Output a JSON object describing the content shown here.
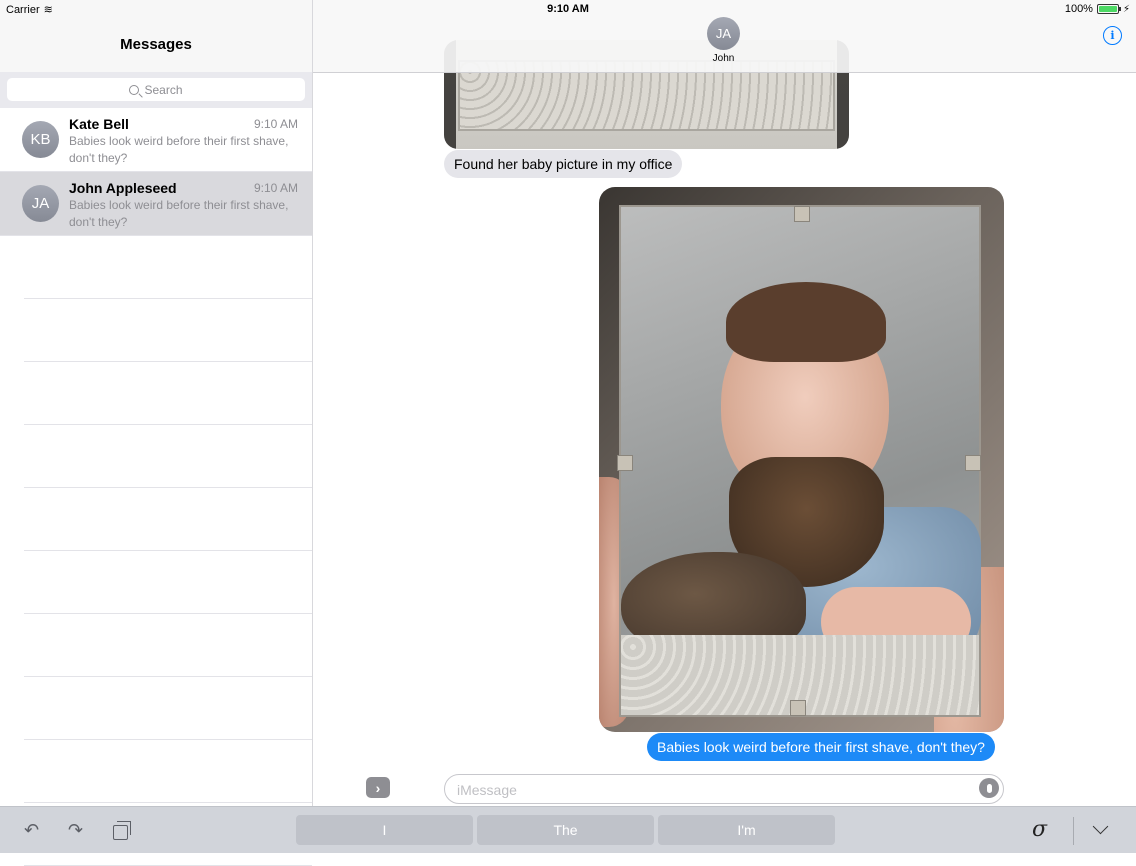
{
  "status_bar": {
    "carrier": "Carrier",
    "time": "9:10 AM",
    "battery": "100%"
  },
  "sidebar": {
    "title": "Messages",
    "search_placeholder": "Search",
    "conversations": [
      {
        "initials": "KB",
        "name": "Kate Bell",
        "time": "9:10 AM",
        "preview": "Babies look weird before their first shave, don't they?",
        "selected": false
      },
      {
        "initials": "JA",
        "name": "John Appleseed",
        "time": "9:10 AM",
        "preview": "Babies look weird before their first shave, don't they?",
        "selected": true
      }
    ]
  },
  "chat": {
    "contact_initials": "JA",
    "contact_name": "John",
    "messages": [
      {
        "type": "image",
        "direction": "received"
      },
      {
        "type": "text",
        "direction": "received",
        "text": "Found her baby picture in my office"
      },
      {
        "type": "image",
        "direction": "sent"
      },
      {
        "type": "text",
        "direction": "sent",
        "text": "Babies look weird before their first shave, don't they?"
      }
    ],
    "input_placeholder": "iMessage",
    "input_value": ""
  },
  "keyboard_bar": {
    "suggestions": [
      "I",
      "The",
      "I'm"
    ],
    "handwriting_glyph": "σ"
  },
  "colors": {
    "accent": "#007aff",
    "sent_bubble": "#1d8af7",
    "received_bubble": "#e5e5ea"
  }
}
